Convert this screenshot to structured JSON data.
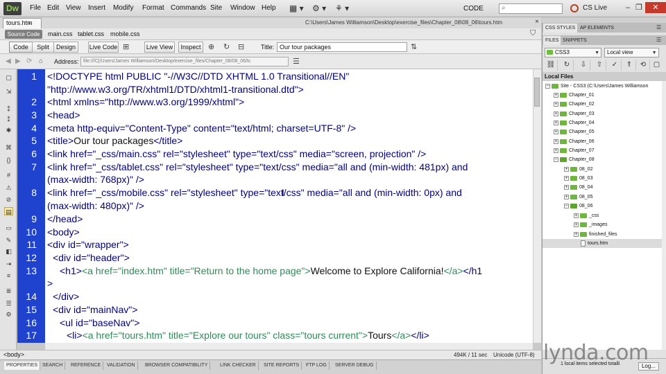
{
  "app": {
    "logo": "Dw"
  },
  "menu": [
    "File",
    "Edit",
    "View",
    "Insert",
    "Modify",
    "Format",
    "Commands",
    "Site",
    "Window",
    "Help"
  ],
  "workspace": {
    "value": "CODE",
    "arrow": "▾"
  },
  "search": {
    "placeholder": ""
  },
  "cslive": "CS Live",
  "window_controls": {
    "minimize": "–",
    "restore": "❐",
    "close": "✕"
  },
  "document": {
    "tab_label": "tours.htm",
    "tab_close": "×",
    "path": "C:\\Users\\James Williamson\\Desktop\\exercise_files\\Chapter_08\\08_06\\tours.htm",
    "close_x": "×"
  },
  "related_files": {
    "active": "Source Code",
    "files": [
      "main.css",
      "tablet.css",
      "mobile.css"
    ]
  },
  "doc_toolbar": {
    "views": [
      "Code",
      "Split",
      "Design"
    ],
    "live_code": "Live Code",
    "live_view": "Live View",
    "inspect": "Inspect",
    "title_label": "Title:",
    "title_value": "Our tour packages"
  },
  "address": {
    "label": "Address:",
    "value": "file:///C|/Users/James Williamson/Desktop/exercise_files/Chapter_08/08_06/tc"
  },
  "code": {
    "line_numbers": [
      "1",
      "2",
      "3",
      "4",
      "5",
      "6",
      "7",
      "8",
      "9",
      "10",
      "11",
      "12",
      "13",
      "14",
      "15",
      "16",
      "17"
    ],
    "lines": [
      "<!DOCTYPE html PUBLIC \"-//W3C//DTD XHTML 1.0 Transitional//EN\"",
      "\"http://www.w3.org/TR/xhtml1/DTD/xhtml1-transitional.dtd\">",
      "<html xmlns=\"http://www.w3.org/1999/xhtml\">",
      "<head>",
      "<meta http-equiv=\"Content-Type\" content=\"text/html; charset=UTF-8\" />",
      "<title>",
      "Our tour packages",
      "</title>",
      "<link href=\"_css/main.css\" rel=\"stylesheet\" type=\"text/css\" media=\"screen, projection\" />",
      "<link href=\"_css/tablet.css\" rel=\"stylesheet\" type=\"text/css\" media=\"all and (min-width: 481px) and",
      "(max-width: 768px)\" />",
      "<link href=\"_css/mobile.css\" rel=\"stylesheet\" type=\"text/css\" media=\"all and (min-width: 0px) and",
      "(max-width: 480px)\" />",
      "</head>",
      "<body>",
      "<div id=\"wrapper\">",
      "<div id=\"header\">",
      "<h1>",
      "<a href=\"index.htm\" title=\"Return to the home page\">",
      "Welcome to Explore California!",
      "</a>",
      "</h1",
      ">",
      "</div>",
      "<div id=\"mainNav\">",
      "<ul id=\"baseNav\">",
      "<li>",
      "<a href=\"tours.htm\" title=\"Explore our tours\" class=\"tours current\">",
      "Tours",
      "</a>",
      "</li>"
    ]
  },
  "status": {
    "tag": "<body>",
    "size": "494K / 11 sec",
    "encoding": "Unicode (UTF-8)"
  },
  "bottom_tabs": [
    "PROPERTIES",
    "SEARCH",
    "REFERENCE",
    "VALIDATION",
    "BROWSER COMPATIBILITY",
    "LINK CHECKER",
    "SITE REPORTS",
    "FTP LOG",
    "SERVER DEBUG"
  ],
  "right_panel": {
    "top_tabs": [
      "CSS STYLES",
      "AP ELEMENTS"
    ],
    "files_tabs": [
      "FILES",
      "SNIPPETS"
    ],
    "site_select": "CSS3",
    "view_select": "Local view",
    "local_files_header": "Local Files",
    "tree": [
      {
        "label": "Site - CSS3 (C:\\Users\\James Williamson",
        "toggle": "−"
      },
      {
        "label": "Chapter_01",
        "toggle": "+"
      },
      {
        "label": "Chapter_02",
        "toggle": "+"
      },
      {
        "label": "Chapter_03",
        "toggle": "+"
      },
      {
        "label": "Chapter_04",
        "toggle": "+"
      },
      {
        "label": "Chapter_05",
        "toggle": "+"
      },
      {
        "label": "Chapter_06",
        "toggle": "+"
      },
      {
        "label": "Chapter_07",
        "toggle": "+"
      },
      {
        "label": "Chapter_08",
        "toggle": "−"
      },
      {
        "label": "08_02",
        "toggle": "+"
      },
      {
        "label": "08_03",
        "toggle": "+"
      },
      {
        "label": "08_04",
        "toggle": "+"
      },
      {
        "label": "08_05",
        "toggle": "+"
      },
      {
        "label": "08_06",
        "toggle": "−"
      },
      {
        "label": "_css",
        "toggle": "+"
      },
      {
        "label": "_images",
        "toggle": "+"
      },
      {
        "label": "finished_files",
        "toggle": "+"
      },
      {
        "label": "tours.htm",
        "toggle": ""
      }
    ],
    "status_text": "1 local items selected totalli",
    "log_button": "Log..."
  },
  "watermark": "lynda.com",
  "colors": {
    "gutter": "#1f43cf",
    "tag": "#000080",
    "attr_value_green": "#2e8b57",
    "folder": "#6db83c"
  },
  "icons": {
    "menubar": [
      "layout-icon",
      "gear-icon",
      "extend-icon"
    ],
    "coding_toolbar": [
      "open-documents-icon",
      "show-code-navigator-icon",
      "collapse-full-tag-icon",
      "collapse-selection-icon",
      "expand-all-icon",
      "select-parent-tag-icon",
      "balance-braces-icon",
      "line-numbers-icon",
      "highlight-invalid-code-icon",
      "syntax-error-alerts-icon",
      "apply-comment-icon",
      "remove-comment-icon",
      "wrap-tag-icon",
      "recent-snippets-icon",
      "move-css-icon",
      "indent-code-icon",
      "outdent-code-icon",
      "format-source-code-icon"
    ]
  }
}
